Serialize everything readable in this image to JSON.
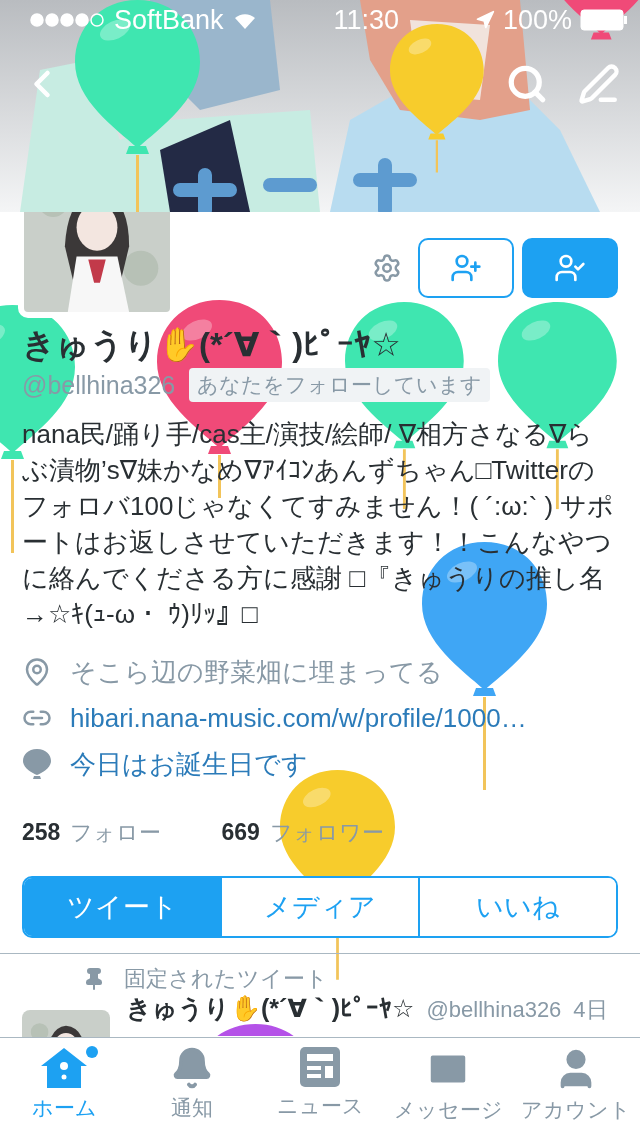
{
  "status_bar": {
    "carrier": "SoftBank",
    "time": "11:30",
    "battery": "100%"
  },
  "profile": {
    "name": "きゅうり✋(*´∀｀)ﾋﾟｰﾔ☆",
    "handle": "@bellhina326",
    "follows_you": "あなたをフォローしています",
    "following": true,
    "bio": "nana民/踊り手/cas主/演技/絵師/ ∇相方さなる∇らぶ漬物’s∇妹かなめ∇ｱｲｺﾝあんずちゃん□Twitterのフォロバ100じゃなくてすみません！( ´:ω:` ) サポートはお返しさせていただきます！！こんなやつに絡んでくださる方に感謝 □『きゅうりの推し名→☆ｷ(ｭ-ω・ ｳ)ﾘｯ』□",
    "location": "そこら辺の野菜畑に埋まってる",
    "url": "hibari.nana-music.com/w/profile/1000…",
    "birthday": "今日はお誕生日です",
    "following_count": "258",
    "following_label": "フォロー",
    "followers_count": "669",
    "followers_label": "フォロワー"
  },
  "tabs": [
    {
      "label": "ツイート",
      "selected": true
    },
    {
      "label": "メディア",
      "selected": false
    },
    {
      "label": "いいね",
      "selected": false
    }
  ],
  "pinned": {
    "label": "固定されたツイート",
    "name": "きゅうり✋(*´∀｀)ﾋﾟｰﾔ☆",
    "handle": "@bellhina326",
    "time": "4日"
  },
  "tab_bar": [
    {
      "kind": "home",
      "label": "ホーム",
      "selected": true,
      "badge": true
    },
    {
      "kind": "bell",
      "label": "通知",
      "selected": false,
      "badge": false
    },
    {
      "kind": "news",
      "label": "ニュース",
      "selected": false,
      "badge": false
    },
    {
      "kind": "mail",
      "label": "メッセージ",
      "selected": false,
      "badge": false
    },
    {
      "kind": "account",
      "label": "アカウント",
      "selected": false,
      "badge": false
    }
  ],
  "balloons": [
    {
      "color": "#3fe6b0"
    },
    {
      "color": "#f7cc2c"
    },
    {
      "color": "#3fe6b0"
    },
    {
      "color": "#3fe6b0"
    },
    {
      "color": "#3fe6b0"
    },
    {
      "color": "#f04a78"
    },
    {
      "color": "#3fa6f5"
    },
    {
      "color": "#f7cc2c"
    },
    {
      "color": "#b452e8"
    },
    {
      "color": "#f04a78"
    }
  ]
}
